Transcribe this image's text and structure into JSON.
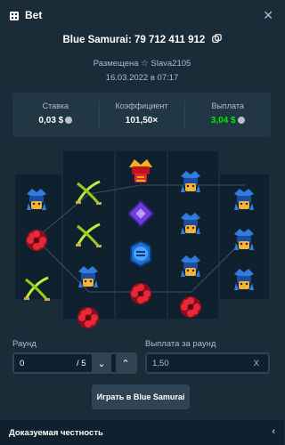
{
  "header": {
    "title": "Bet",
    "icon": "bet-slip-icon",
    "close_icon": "close-icon"
  },
  "bet": {
    "game_title": "Blue Samurai: 79 712 411 912",
    "placed_label": "Размещена",
    "username": "Slava2105",
    "date": "16.03.2022 в 07:17"
  },
  "stats": {
    "stake_label": "Ставка",
    "stake_value": "0,03 $",
    "multiplier_label": "Коэффициент",
    "multiplier_value": "101,50×",
    "payout_label": "Выплата",
    "payout_value": "3,04 $"
  },
  "reels": {
    "symbols": [
      [
        "samurai-blue",
        "flower-red",
        "sword-green"
      ],
      [
        "sword-green",
        "sword-green",
        "samurai-blue",
        "flower-red"
      ],
      [
        "samurai-red-helmet",
        "gem-purple",
        "coin-blue",
        "flower-red"
      ],
      [
        "samurai-blue",
        "samurai-blue",
        "samurai-blue",
        "flower-red"
      ],
      [
        "samurai-blue",
        "samurai-blue",
        "samurai-blue"
      ]
    ]
  },
  "controls": {
    "round_label": "Раунд",
    "round_value": "0",
    "round_total": "/ 5",
    "payout_round_label": "Выплата за раунд",
    "payout_round_value": "1,50",
    "play_button": "Играть в Blue Samurai"
  },
  "footer": {
    "label": "Доказуемая честность"
  },
  "colors": {
    "bg": "#1a2c38",
    "panel": "#213743",
    "dark": "#0f212e",
    "green": "#00e701",
    "muted": "#b1bad3"
  }
}
